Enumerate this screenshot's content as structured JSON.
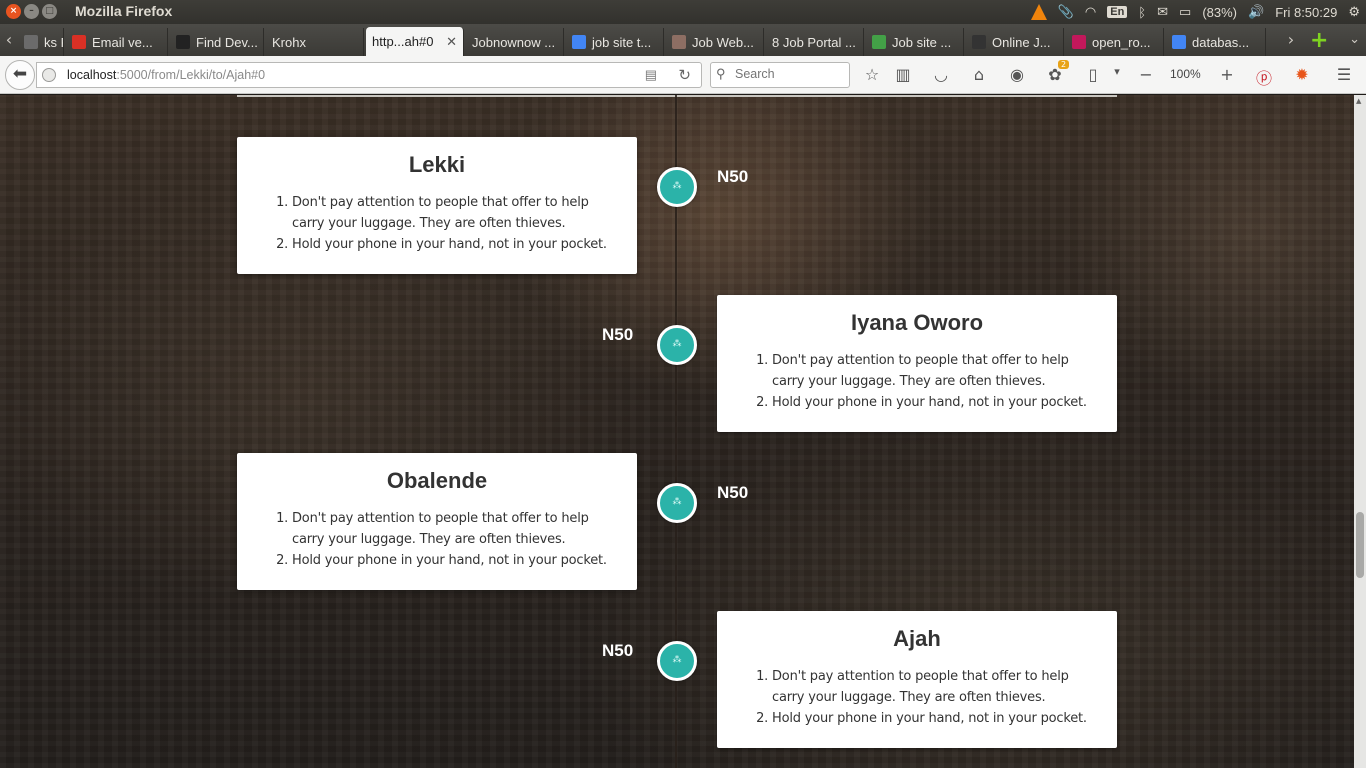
{
  "system_panel": {
    "app_title": "Mozilla Firefox",
    "keyboard_layout": "En",
    "battery": "(83%)",
    "clock": "Fri  8:50:29"
  },
  "tabs": [
    {
      "label": "ks F...",
      "favicon_color": "#6b6b6b"
    },
    {
      "label": "Email ve...",
      "favicon_color": "#d93025"
    },
    {
      "label": "Find Dev...",
      "favicon_color": "#222222"
    },
    {
      "label": "Krohx",
      "favicon_color": ""
    },
    {
      "label": "http...ah#0",
      "favicon_color": "",
      "active": true
    },
    {
      "label": "Jobnownow ...",
      "favicon_color": ""
    },
    {
      "label": "job site t...",
      "favicon_color": "#4285f4"
    },
    {
      "label": "Job Web...",
      "favicon_color": "#8d6e63"
    },
    {
      "label": "8 Job Portal ...",
      "favicon_color": ""
    },
    {
      "label": "Job site ...",
      "favicon_color": "#43a047"
    },
    {
      "label": "Online J...",
      "favicon_color": "#333333"
    },
    {
      "label": "open_ro...",
      "favicon_color": "#c2185b"
    },
    {
      "label": "databas...",
      "favicon_color": "#4285f4"
    }
  ],
  "navbar": {
    "url_host": "localhost",
    "url_path": ":5000/from/Lekki/to/Ajah#0",
    "search_placeholder": "Search",
    "zoom": "100%",
    "addon_badge": "2"
  },
  "timeline": {
    "accent_color": "#2bb3a9",
    "stops": [
      {
        "name": "Lekki",
        "fare": "N50",
        "tips": [
          "Don't pay attention to people that offer to help carry your luggage. They are often thieves.",
          "Hold your phone in your hand, not in your pocket."
        ]
      },
      {
        "name": "Iyana Oworo",
        "fare": "N50",
        "tips": [
          "Don't pay attention to people that offer to help carry your luggage. They are often thieves.",
          "Hold your phone in your hand, not in your pocket."
        ]
      },
      {
        "name": "Obalende",
        "fare": "N50",
        "tips": [
          "Don't pay attention to people that offer to help carry your luggage. They are often thieves.",
          "Hold your phone in your hand, not in your pocket."
        ]
      },
      {
        "name": "Ajah",
        "fare": "N50",
        "tips": [
          "Don't pay attention to people that offer to help carry your luggage. They are often thieves.",
          "Hold your phone in your hand, not in your pocket."
        ]
      }
    ]
  }
}
